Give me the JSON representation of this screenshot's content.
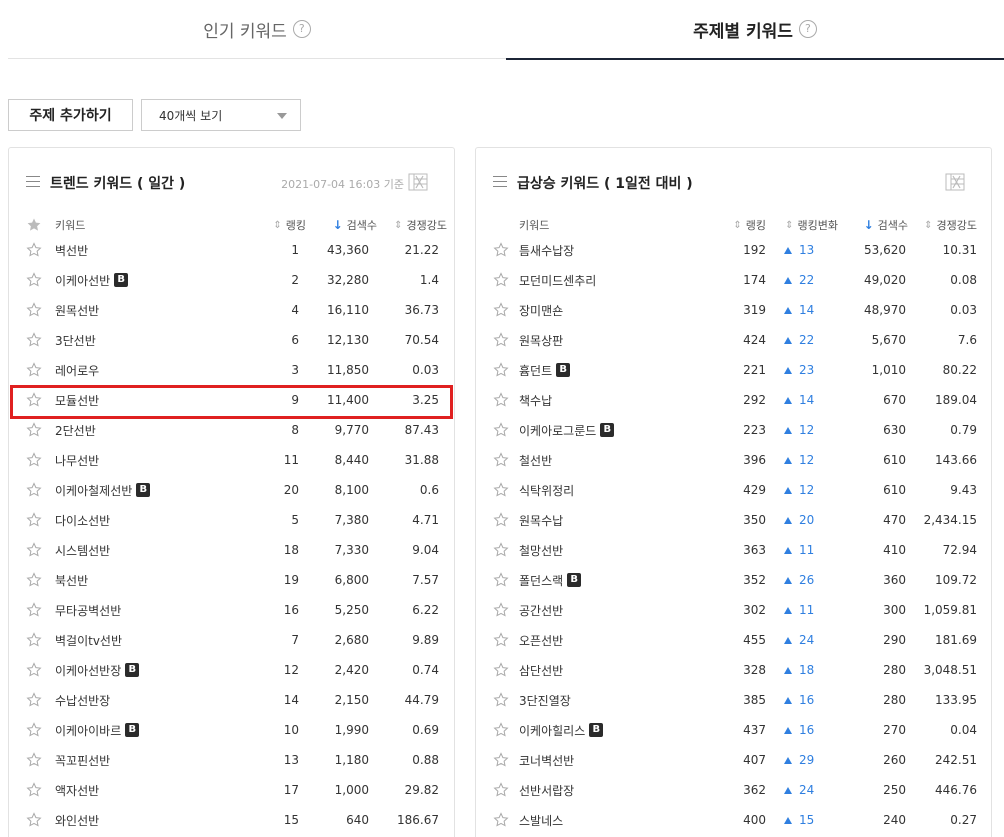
{
  "tabs": [
    {
      "label": "인기 키워드",
      "active": false
    },
    {
      "label": "주제별 키워드",
      "active": true
    }
  ],
  "help_glyph": "?",
  "controls": {
    "add_button": "주제 추가하기",
    "view_select": "40개씩 보기"
  },
  "left_panel": {
    "title": "트렌드 키워드 ( 일간 )",
    "date": "2021-07-04 16:03 기준",
    "headers": {
      "keyword": "키워드",
      "rank": "랭킹",
      "search": "검색수",
      "competition": "경쟁강도"
    },
    "rows": [
      {
        "keyword": "벽선반",
        "b": false,
        "rank": "1",
        "search": "43,360",
        "comp": "21.22"
      },
      {
        "keyword": "이케아선반",
        "b": true,
        "rank": "2",
        "search": "32,280",
        "comp": "1.4"
      },
      {
        "keyword": "원목선반",
        "b": false,
        "rank": "4",
        "search": "16,110",
        "comp": "36.73"
      },
      {
        "keyword": "3단선반",
        "b": false,
        "rank": "6",
        "search": "12,130",
        "comp": "70.54"
      },
      {
        "keyword": "레어로우",
        "b": false,
        "rank": "3",
        "search": "11,850",
        "comp": "0.03"
      },
      {
        "keyword": "모듈선반",
        "b": false,
        "rank": "9",
        "search": "11,400",
        "comp": "3.25"
      },
      {
        "keyword": "2단선반",
        "b": false,
        "rank": "8",
        "search": "9,770",
        "comp": "87.43"
      },
      {
        "keyword": "나무선반",
        "b": false,
        "rank": "11",
        "search": "8,440",
        "comp": "31.88"
      },
      {
        "keyword": "이케아철제선반",
        "b": true,
        "rank": "20",
        "search": "8,100",
        "comp": "0.6"
      },
      {
        "keyword": "다이소선반",
        "b": false,
        "rank": "5",
        "search": "7,380",
        "comp": "4.71"
      },
      {
        "keyword": "시스템선반",
        "b": false,
        "rank": "18",
        "search": "7,330",
        "comp": "9.04"
      },
      {
        "keyword": "북선반",
        "b": false,
        "rank": "19",
        "search": "6,800",
        "comp": "7.57"
      },
      {
        "keyword": "무타공벽선반",
        "b": false,
        "rank": "16",
        "search": "5,250",
        "comp": "6.22"
      },
      {
        "keyword": "벽걸이tv선반",
        "b": false,
        "rank": "7",
        "search": "2,680",
        "comp": "9.89"
      },
      {
        "keyword": "이케아선반장",
        "b": true,
        "rank": "12",
        "search": "2,420",
        "comp": "0.74"
      },
      {
        "keyword": "수납선반장",
        "b": false,
        "rank": "14",
        "search": "2,150",
        "comp": "44.79"
      },
      {
        "keyword": "이케아이바르",
        "b": true,
        "rank": "10",
        "search": "1,990",
        "comp": "0.69"
      },
      {
        "keyword": "꼭꼬핀선반",
        "b": false,
        "rank": "13",
        "search": "1,180",
        "comp": "0.88"
      },
      {
        "keyword": "액자선반",
        "b": false,
        "rank": "17",
        "search": "1,000",
        "comp": "29.82"
      },
      {
        "keyword": "와인선반",
        "b": false,
        "rank": "15",
        "search": "640",
        "comp": "186.67"
      }
    ]
  },
  "right_panel": {
    "title": "급상승 키워드 ( 1일전 대비 )",
    "headers": {
      "keyword": "키워드",
      "rank": "랭킹",
      "change": "랭킹변화",
      "search": "검색수",
      "competition": "경쟁강도"
    },
    "rows": [
      {
        "keyword": "틈새수납장",
        "b": false,
        "rank": "192",
        "change": "13",
        "search": "53,620",
        "comp": "10.31"
      },
      {
        "keyword": "모던미드센추리",
        "b": false,
        "rank": "174",
        "change": "22",
        "search": "49,020",
        "comp": "0.08"
      },
      {
        "keyword": "장미맨숀",
        "b": false,
        "rank": "319",
        "change": "14",
        "search": "48,970",
        "comp": "0.03"
      },
      {
        "keyword": "원목상판",
        "b": false,
        "rank": "424",
        "change": "22",
        "search": "5,670",
        "comp": "7.6"
      },
      {
        "keyword": "흄던트",
        "b": true,
        "rank": "221",
        "change": "23",
        "search": "1,010",
        "comp": "80.22"
      },
      {
        "keyword": "책수납",
        "b": false,
        "rank": "292",
        "change": "14",
        "search": "670",
        "comp": "189.04"
      },
      {
        "keyword": "이케아로그룬드",
        "b": true,
        "rank": "223",
        "change": "12",
        "search": "630",
        "comp": "0.79"
      },
      {
        "keyword": "철선반",
        "b": false,
        "rank": "396",
        "change": "12",
        "search": "610",
        "comp": "143.66"
      },
      {
        "keyword": "식탁위정리",
        "b": false,
        "rank": "429",
        "change": "12",
        "search": "610",
        "comp": "9.43"
      },
      {
        "keyword": "원목수납",
        "b": false,
        "rank": "350",
        "change": "20",
        "search": "470",
        "comp": "2,434.15"
      },
      {
        "keyword": "철망선반",
        "b": false,
        "rank": "363",
        "change": "11",
        "search": "410",
        "comp": "72.94"
      },
      {
        "keyword": "폴던스랙",
        "b": true,
        "rank": "352",
        "change": "26",
        "search": "360",
        "comp": "109.72"
      },
      {
        "keyword": "공간선반",
        "b": false,
        "rank": "302",
        "change": "11",
        "search": "300",
        "comp": "1,059.81"
      },
      {
        "keyword": "오픈선반",
        "b": false,
        "rank": "455",
        "change": "24",
        "search": "290",
        "comp": "181.69"
      },
      {
        "keyword": "삼단선반",
        "b": false,
        "rank": "328",
        "change": "18",
        "search": "280",
        "comp": "3,048.51"
      },
      {
        "keyword": "3단진열장",
        "b": false,
        "rank": "385",
        "change": "16",
        "search": "280",
        "comp": "133.95"
      },
      {
        "keyword": "이케아힐리스",
        "b": true,
        "rank": "437",
        "change": "16",
        "search": "270",
        "comp": "0.04"
      },
      {
        "keyword": "코너벽선반",
        "b": false,
        "rank": "407",
        "change": "29",
        "search": "260",
        "comp": "242.51"
      },
      {
        "keyword": "선반서랍장",
        "b": false,
        "rank": "362",
        "change": "24",
        "search": "250",
        "comp": "446.76"
      },
      {
        "keyword": "스발네스",
        "b": false,
        "rank": "400",
        "change": "15",
        "search": "240",
        "comp": "0.27"
      }
    ]
  },
  "badge_label": "B",
  "highlighted_keyword": "모듈선반",
  "colors": {
    "accent": "#2f7fe0",
    "highlight": "#e02020",
    "active_tab_bar": "#1c2536"
  }
}
